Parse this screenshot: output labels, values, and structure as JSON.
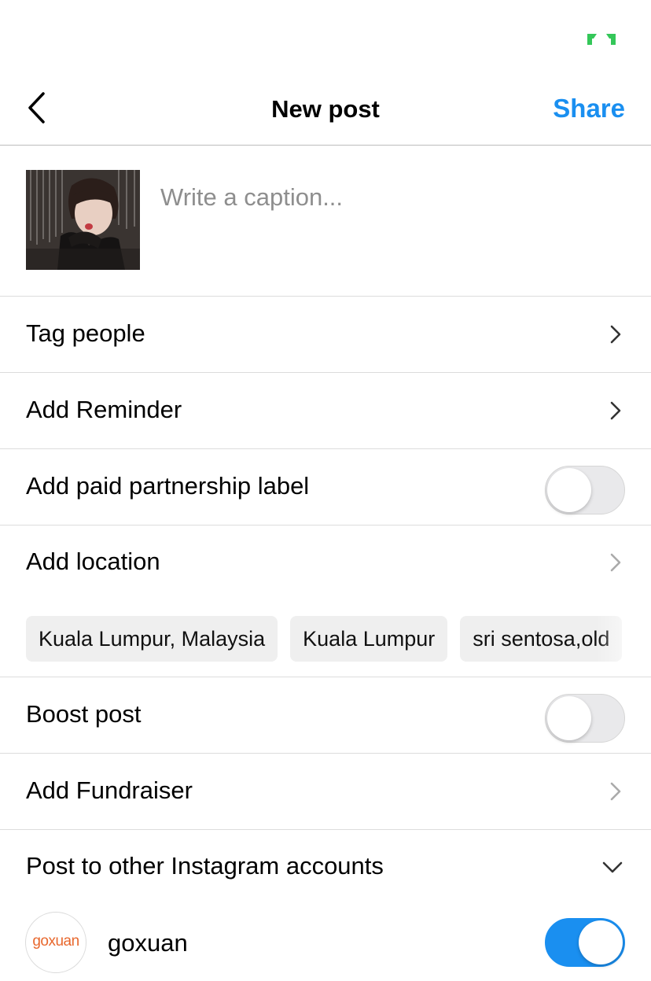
{
  "status_bar": {
    "indicator_icon": "camera-in-use-indicator",
    "indicator_color": "#34c759"
  },
  "header": {
    "back_icon": "chevron-left-icon",
    "title": "New post",
    "share_label": "Share",
    "accent_color": "#1a8ff0"
  },
  "caption": {
    "placeholder": "Write a caption...",
    "value": ""
  },
  "rows": {
    "tag_people": {
      "label": "Tag people"
    },
    "add_reminder": {
      "label": "Add Reminder"
    },
    "paid_partnership": {
      "label": "Add paid partnership label",
      "toggle_on": false
    },
    "add_location": {
      "label": "Add location"
    },
    "boost_post": {
      "label": "Boost post",
      "toggle_on": false
    },
    "add_fundraiser": {
      "label": "Add Fundraiser"
    }
  },
  "location_suggestions": [
    "Kuala Lumpur, Malaysia",
    "Kuala Lumpur",
    "sri sentosa,old"
  ],
  "other_accounts": {
    "label": "Post to other Instagram accounts",
    "expand_icon": "chevron-down-icon",
    "accounts": [
      {
        "avatar_text": "goxuan",
        "username": "goxuan",
        "toggle_on": true
      }
    ]
  }
}
